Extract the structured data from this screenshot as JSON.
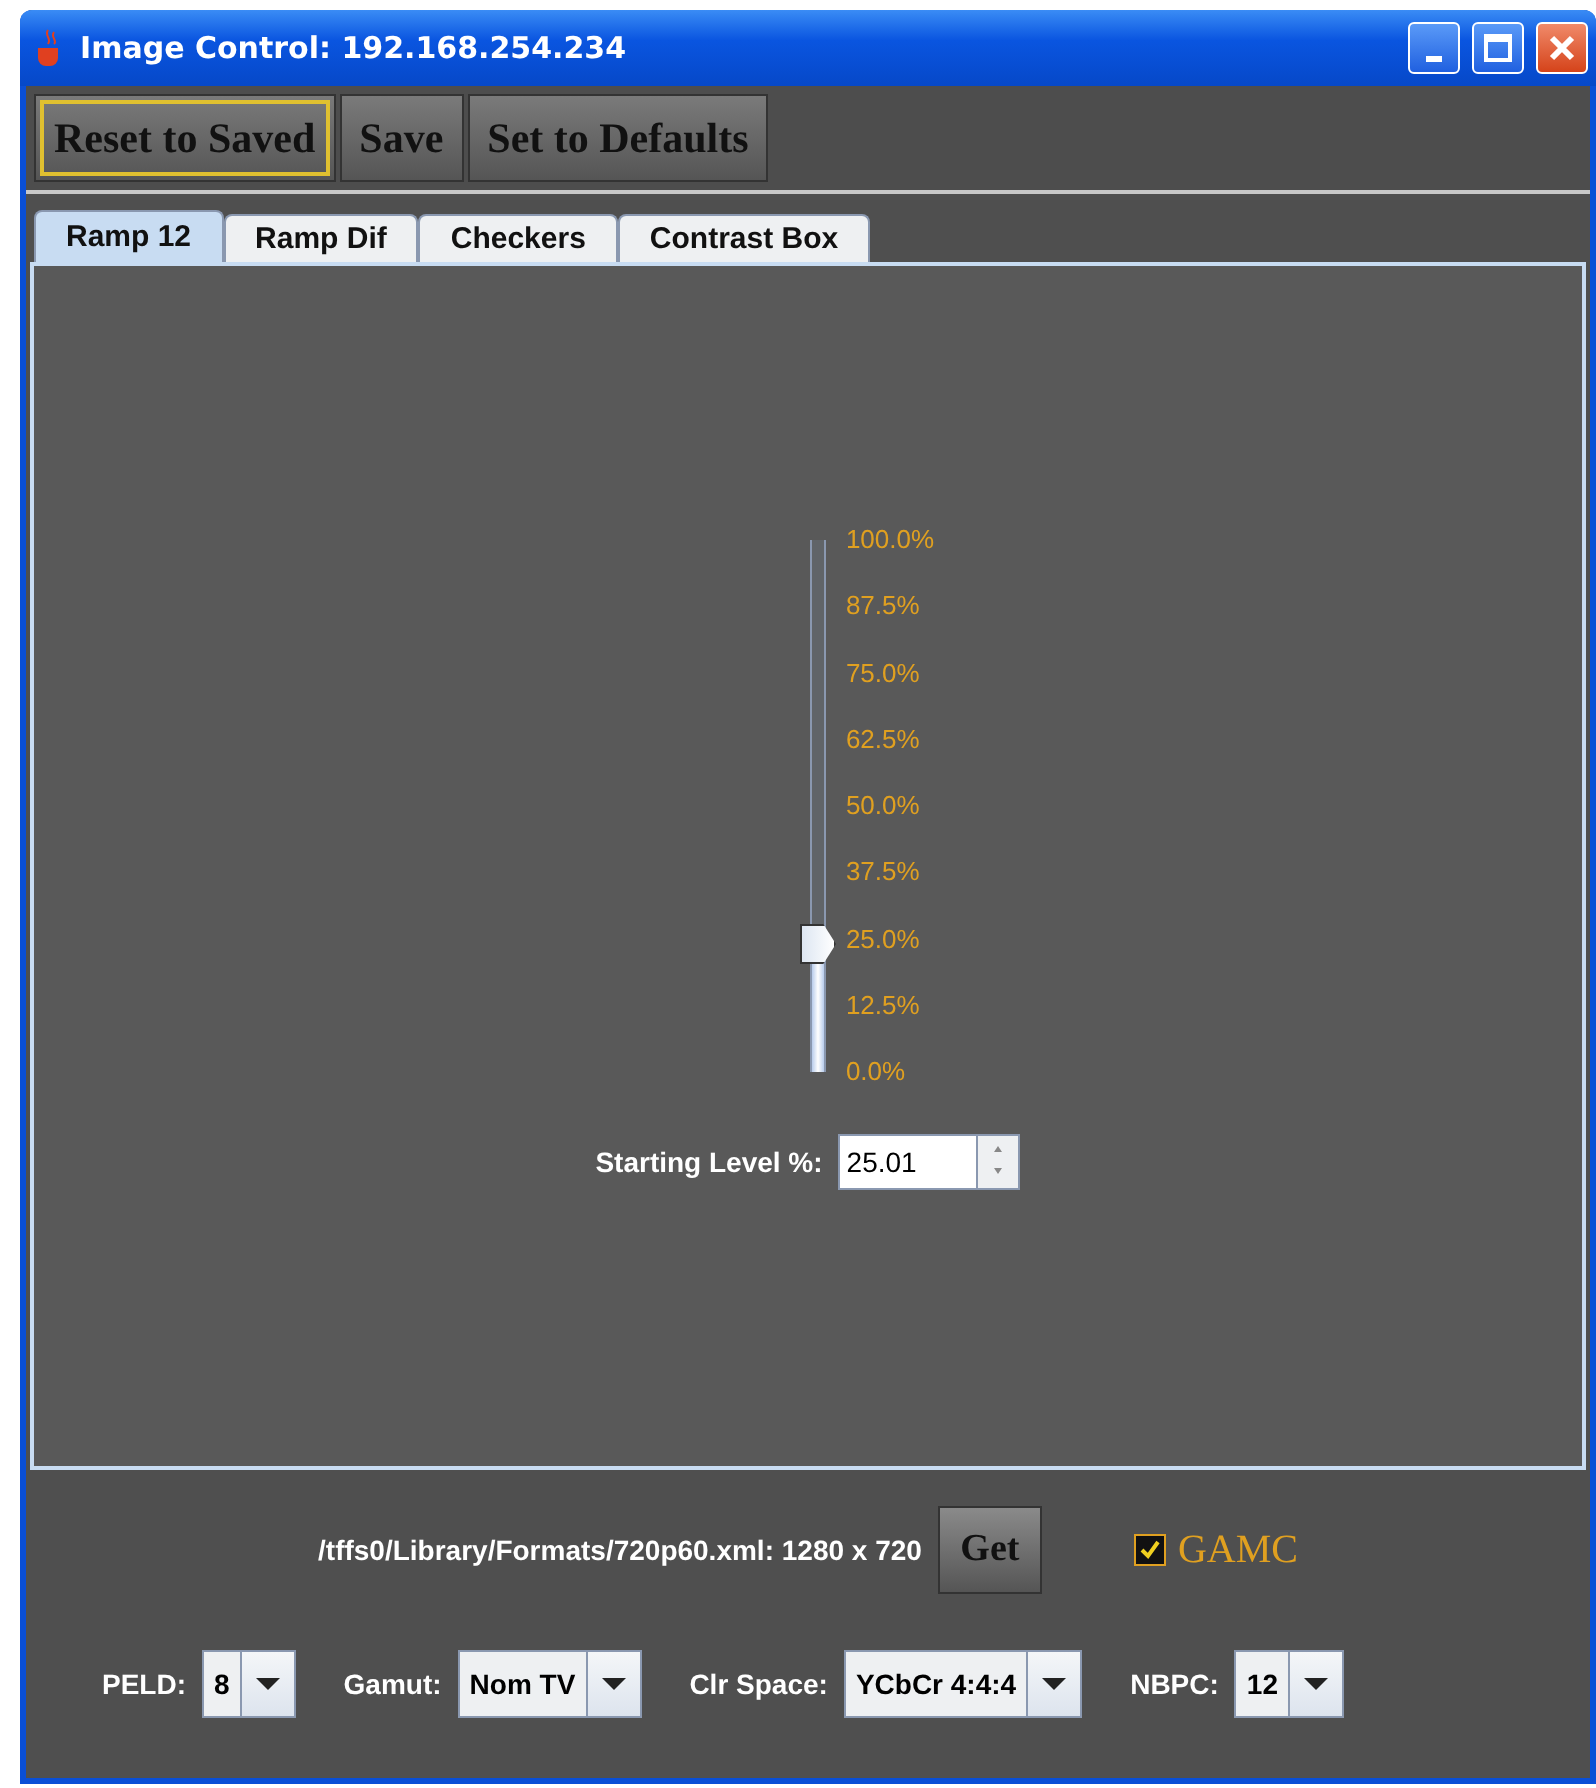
{
  "window": {
    "title": "Image Control: 192.168.254.234"
  },
  "toolbar": [
    {
      "label": "Reset to Saved",
      "focused": true
    },
    {
      "label": "Save",
      "focused": false
    },
    {
      "label": "Set to Defaults",
      "focused": false
    }
  ],
  "tabs": [
    {
      "label": "Ramp 12",
      "selected": true
    },
    {
      "label": "Ramp Dif",
      "selected": false
    },
    {
      "label": "Checkers",
      "selected": false
    },
    {
      "label": "Contrast Box",
      "selected": false
    }
  ],
  "slider": {
    "level": 0.25,
    "ticks": [
      "100.0%",
      "87.5%",
      "75.0%",
      "62.5%",
      "50.0%",
      "37.5%",
      "25.0%",
      "12.5%",
      "0.0%"
    ]
  },
  "starting_level": {
    "label": "Starting Level %:",
    "value": "25.01"
  },
  "format": {
    "path": "/tffs0/Library/Formats/720p60.xml: 1280 x 720",
    "button": "Get"
  },
  "gamc": {
    "label": "GAMC",
    "checked": true
  },
  "selects": [
    {
      "label": "PELD:",
      "value": "8"
    },
    {
      "label": "Gamut:",
      "value": "Nom TV"
    },
    {
      "label": "Clr Space:",
      "value": "YCbCr 4:4:4"
    },
    {
      "label": "NBPC:",
      "value": "12"
    }
  ]
}
